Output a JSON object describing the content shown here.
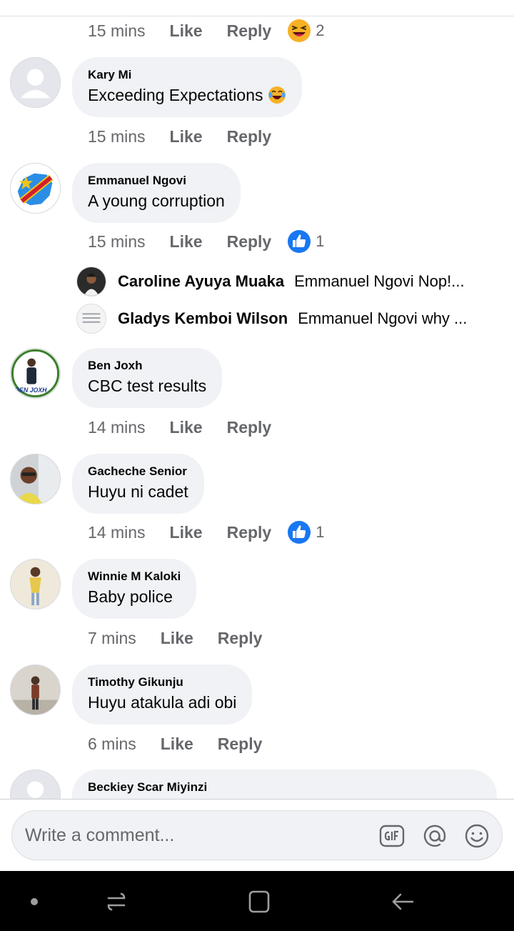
{
  "top_meta": {
    "time": "15 mins",
    "like": "Like",
    "reply": "Reply",
    "reaction_icon": "laughing-emoji-icon",
    "reaction_count": "2"
  },
  "comments": [
    {
      "name": "Kary Mi",
      "text": "Exceeding Expectations",
      "trailing_emoji": "tears-of-joy-emoji-icon",
      "time": "15 mins",
      "like": "Like",
      "reply": "Reply"
    },
    {
      "name": "Emmanuel Ngovi",
      "text": "A young corruption",
      "time": "15 mins",
      "like": "Like",
      "reply": "Reply",
      "reaction_icon": "thumbs-up-icon",
      "reaction_count": "1",
      "replies": [
        {
          "name": "Caroline Ayuya Muaka",
          "text": "Emmanuel Ngovi  Nop!..."
        },
        {
          "name": "Gladys Kemboi Wilson",
          "text": "Emmanuel Ngovi why ..."
        }
      ]
    },
    {
      "name": "Ben Joxh",
      "text": "CBC test results",
      "time": "14 mins",
      "like": "Like",
      "reply": "Reply",
      "avatar_caption": "BEN JOXH"
    },
    {
      "name": "Gacheche Senior",
      "text": "Huyu ni cadet",
      "time": "14 mins",
      "like": "Like",
      "reply": "Reply",
      "reaction_icon": "thumbs-up-icon",
      "reaction_count": "1"
    },
    {
      "name": "Winnie M Kaloki",
      "text": "Baby police",
      "time": "7 mins",
      "like": "Like",
      "reply": "Reply"
    },
    {
      "name": "Timothy Gikunju",
      "text": "Huyu atakula adi obi",
      "time": "6 mins",
      "like": "Like",
      "reply": "Reply"
    },
    {
      "name": "Beckiey Scar Miyinzi"
    }
  ],
  "composer": {
    "placeholder": "Write a comment...",
    "icons": [
      "gif-icon",
      "mention-icon",
      "emoji-icon"
    ]
  },
  "system_nav": {
    "icons": [
      "dot-icon",
      "recents-icon",
      "home-icon",
      "back-icon"
    ]
  },
  "colors": {
    "bubble": "#f0f2f5",
    "meta_text": "#65676b",
    "like_blue": "#1877f2",
    "nav_bar": "#000000"
  }
}
